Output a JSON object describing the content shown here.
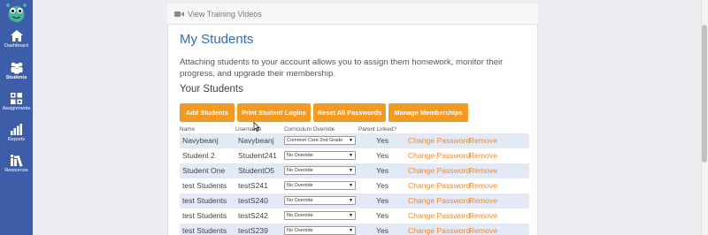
{
  "sidebar": {
    "items": [
      {
        "label": "Dashboard",
        "icon": "home-icon"
      },
      {
        "label": "Students",
        "icon": "users-icon"
      },
      {
        "label": "Assignments",
        "icon": "grid-icon"
      },
      {
        "label": "Reports",
        "icon": "bar-chart-icon"
      },
      {
        "label": "Resources",
        "icon": "books-icon"
      }
    ],
    "active": "Students"
  },
  "tab": {
    "label": "View Training Videos",
    "icon": "video-camera-icon"
  },
  "page": {
    "title": "My Students",
    "intro": "Attaching students to your account allows you to assign them homework, monitor their progress, and upgrade their membership.",
    "section_title": "Your Students"
  },
  "buttons": {
    "add": "Add Students",
    "print": "Print Student Logins",
    "reset": "Reset All Passwords",
    "manage": "Manage Memberships"
  },
  "table": {
    "headers": {
      "name": "Name",
      "username": "Username",
      "curriculum": "Curriculum Override",
      "parent": "Parent Linked?"
    },
    "rows": [
      {
        "name": "Navybeanj",
        "username": "Navybeanj",
        "curriculum": "Common Core 2nd Grade",
        "parent": "Yes",
        "change": "Change Password",
        "remove": "Remove"
      },
      {
        "name": "Student 2",
        "username": "Student241",
        "curriculum": "No Override",
        "parent": "Yes",
        "change": "Change Password",
        "remove": "Remove"
      },
      {
        "name": "Student One",
        "username": "StudentO5",
        "curriculum": "No Override",
        "parent": "Yes",
        "change": "Change Password",
        "remove": "Remove"
      },
      {
        "name": "test Students",
        "username": "testS241",
        "curriculum": "No Override",
        "parent": "Yes",
        "change": "Change Password",
        "remove": "Remove"
      },
      {
        "name": "test Students",
        "username": "testS240",
        "curriculum": "No Override",
        "parent": "Yes",
        "change": "Change Password",
        "remove": "Remove"
      },
      {
        "name": "test Students",
        "username": "testS242",
        "curriculum": "No Override",
        "parent": "Yes",
        "change": "Change Password",
        "remove": "Remove"
      },
      {
        "name": "test Students",
        "username": "testS239",
        "curriculum": "No Override",
        "parent": "Yes",
        "change": "Change Password",
        "remove": "Remove"
      }
    ]
  },
  "colors": {
    "sidebar": "#3d5da8",
    "button": "#f39a22",
    "link": "#f08a24",
    "title": "#2e6bb3",
    "row_alt": "#e3e9f7"
  }
}
